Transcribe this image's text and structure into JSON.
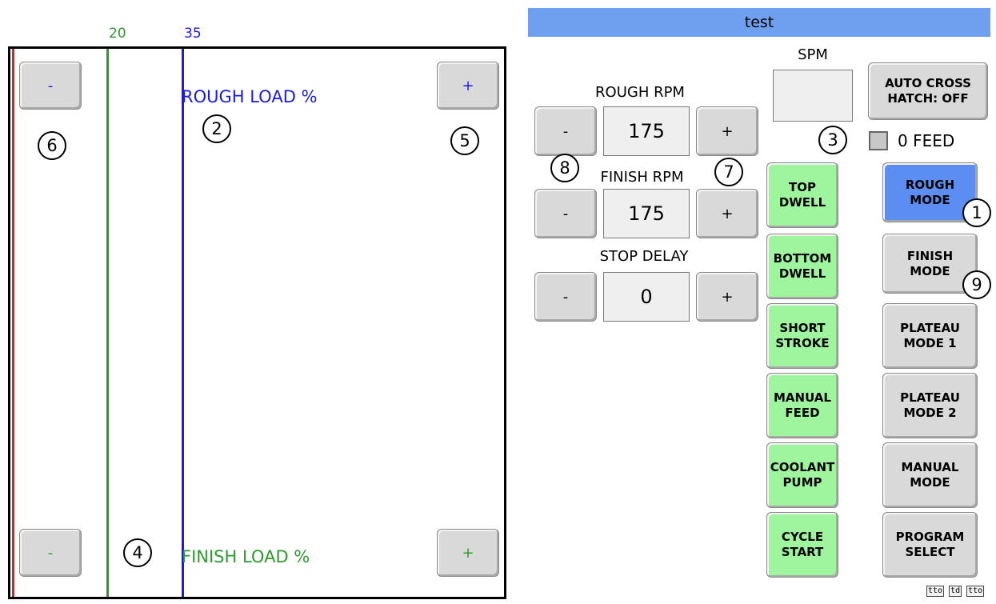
{
  "title": "test",
  "scale": {
    "green_label": "20",
    "blue_label": "35"
  },
  "load": {
    "rough_label": "ROUGH LOAD %",
    "finish_label": "FINISH LOAD %",
    "rough_minus": "-",
    "rough_plus": "+",
    "finish_minus": "-",
    "finish_plus": "+"
  },
  "callouts": {
    "c1": "1",
    "c2": "2",
    "c3": "3",
    "c4": "4",
    "c5": "5",
    "c6": "6",
    "c7": "7",
    "c8": "8",
    "c9": "9"
  },
  "rough_rpm": {
    "label": "ROUGH RPM",
    "value": "175",
    "minus": "-",
    "plus": "+"
  },
  "finish_rpm": {
    "label": "FINISH RPM",
    "value": "175",
    "minus": "-",
    "plus": "+"
  },
  "stop_delay": {
    "label": "STOP DELAY",
    "value": "0",
    "minus": "-",
    "plus": "+"
  },
  "spm": {
    "label": "SPM"
  },
  "auto_cross_hatch": {
    "line1": "AUTO CROSS",
    "line2": "HATCH: OFF"
  },
  "zero_feed": {
    "label": "0 FEED"
  },
  "green_buttons": [
    {
      "line1": "TOP",
      "line2": "DWELL"
    },
    {
      "line1": "BOTTOM",
      "line2": "DWELL"
    },
    {
      "line1": "SHORT",
      "line2": "STROKE"
    },
    {
      "line1": "MANUAL",
      "line2": "FEED"
    },
    {
      "line1": "COOLANT",
      "line2": "PUMP"
    },
    {
      "line1": "CYCLE",
      "line2": "START"
    }
  ],
  "mode_buttons": [
    {
      "line1": "ROUGH",
      "line2": "MODE"
    },
    {
      "line1": "FINISH",
      "line2": "MODE"
    },
    {
      "line1": "PLATEAU",
      "line2": "MODE 1"
    },
    {
      "line1": "PLATEAU",
      "line2": "MODE 2"
    },
    {
      "line1": "MANUAL",
      "line2": "MODE"
    },
    {
      "line1": "PROGRAM",
      "line2": "SELECT"
    }
  ],
  "footer": {
    "a": "tto",
    "b": "td",
    "c": "tto"
  },
  "colors": {
    "red_line": "#e02020",
    "green_line": "#2e9a2e",
    "blue_line": "#1a1aee",
    "active_mode": "#5b8ef0",
    "green_button": "#9ef59e",
    "title_bar": "#6fa0ef"
  }
}
